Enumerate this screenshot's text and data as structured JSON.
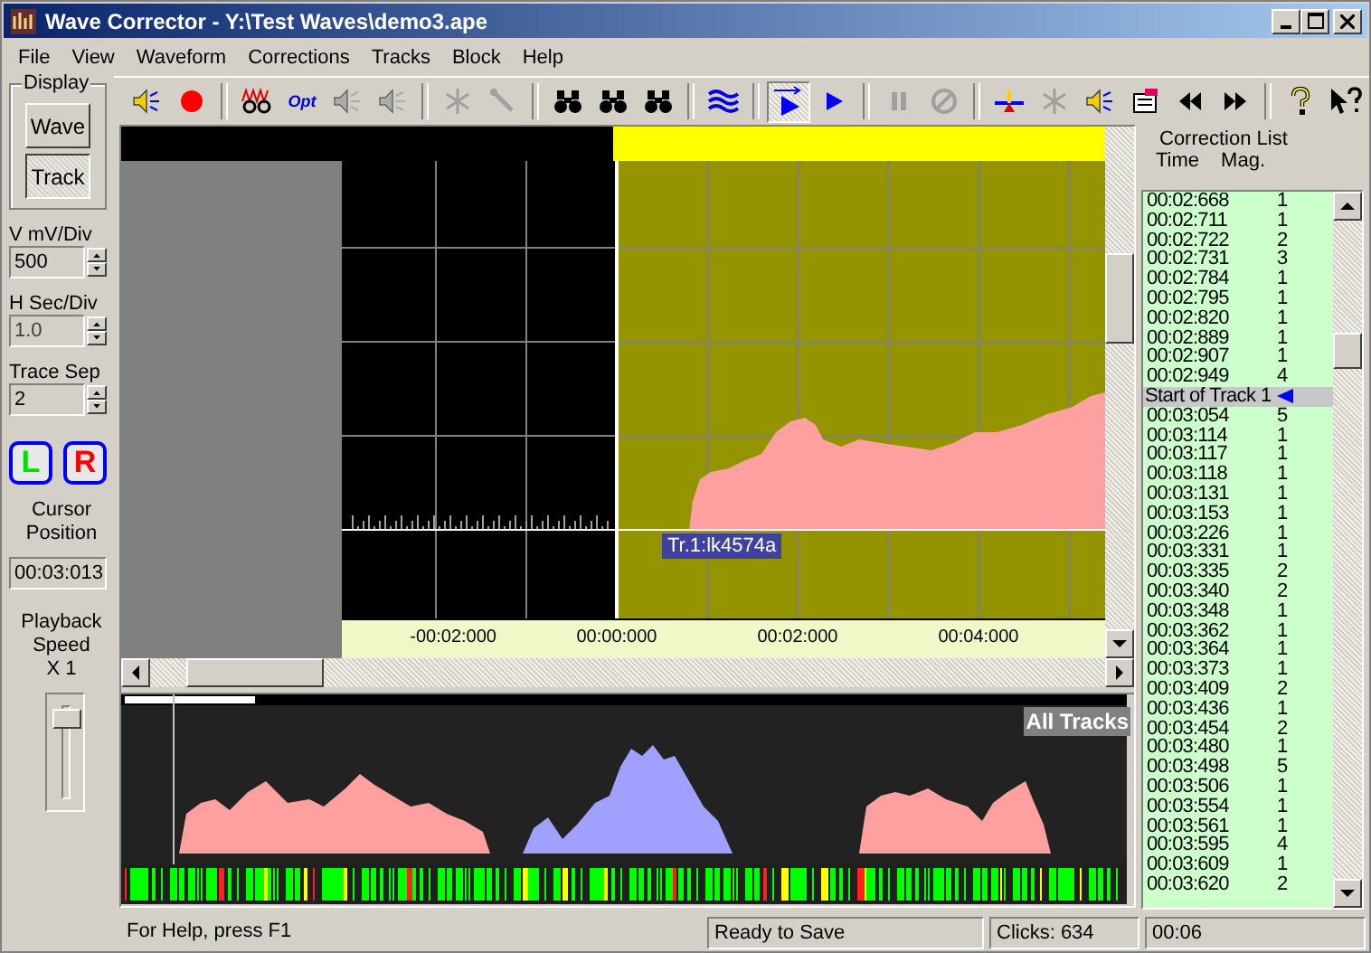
{
  "window": {
    "title": "Wave Corrector - Y:\\Test Waves\\demo3.ape"
  },
  "menu": [
    "File",
    "View",
    "Waveform",
    "Corrections",
    "Tracks",
    "Block",
    "Help"
  ],
  "toolbar": [
    [
      {
        "kind": "speaker",
        "disabled": false,
        "pressed": false
      },
      {
        "kind": "record",
        "disabled": false,
        "pressed": false
      }
    ],
    [
      {
        "kind": "glasses",
        "disabled": false,
        "pressed": false
      },
      {
        "kind": "text",
        "label": "Opt",
        "disabled": false,
        "pressed": false
      },
      {
        "kind": "speaker",
        "disabled": true,
        "pressed": false
      },
      {
        "kind": "speaker",
        "disabled": true,
        "pressed": false
      }
    ],
    [
      {
        "kind": "asterisk",
        "disabled": true,
        "pressed": false
      },
      {
        "kind": "wrench",
        "disabled": true,
        "pressed": false
      }
    ],
    [
      {
        "kind": "binoculars",
        "disabled": false,
        "pressed": false
      },
      {
        "kind": "binoculars",
        "disabled": false,
        "pressed": false
      },
      {
        "kind": "binoculars",
        "disabled": false,
        "pressed": false
      }
    ],
    [
      {
        "kind": "waves",
        "disabled": false,
        "pressed": false
      }
    ],
    [
      {
        "kind": "play-range",
        "disabled": false,
        "pressed": true
      },
      {
        "kind": "play",
        "disabled": false,
        "pressed": false
      }
    ],
    [
      {
        "kind": "pause",
        "disabled": true,
        "pressed": false
      },
      {
        "kind": "stop",
        "disabled": true,
        "pressed": false
      }
    ],
    [
      {
        "kind": "marker",
        "disabled": false,
        "pressed": false
      },
      {
        "kind": "asterisk",
        "disabled": true,
        "pressed": false
      },
      {
        "kind": "speaker",
        "disabled": false,
        "pressed": false
      },
      {
        "kind": "card",
        "disabled": false,
        "pressed": false
      },
      {
        "kind": "rewind",
        "disabled": false,
        "pressed": false
      },
      {
        "kind": "forward",
        "disabled": false,
        "pressed": false
      }
    ],
    [
      {
        "kind": "help",
        "disabled": false,
        "pressed": false
      },
      {
        "kind": "whats-this",
        "disabled": false,
        "pressed": false
      }
    ]
  ],
  "display": {
    "label": "Display",
    "buttons": [
      {
        "label": "Wave",
        "selected": false
      },
      {
        "label": "Track",
        "selected": true
      }
    ]
  },
  "spinners": [
    {
      "label": "V mV/Div",
      "value": "500",
      "disabled": false
    },
    {
      "label": "H Sec/Div",
      "value": "1.0",
      "disabled": true
    },
    {
      "label": "Trace Sep",
      "value": "2",
      "disabled": false
    }
  ],
  "channels": [
    {
      "label": "L",
      "color": "#00e000"
    },
    {
      "label": "R",
      "color": "#ff0000"
    }
  ],
  "cursor": {
    "label": "Cursor Position",
    "value": "00:03:013"
  },
  "playback": {
    "label": "Playback Speed",
    "speed": "X 1",
    "level": 0.9
  },
  "waveform": {
    "ruler": [
      "-00:02:000",
      "00:00:000",
      "00:02:000",
      "00:04:000"
    ],
    "track_label": "Tr.1:lk4574a"
  },
  "overview": {
    "label": "All Tracks"
  },
  "correction_list": {
    "title": "Correction List",
    "columns": [
      "Time",
      "Mag."
    ],
    "rows": [
      {
        "kind": "correction",
        "time": "00:02:668",
        "mag": "1"
      },
      {
        "kind": "correction",
        "time": "00:02:711",
        "mag": "1"
      },
      {
        "kind": "correction",
        "time": "00:02:722",
        "mag": "2"
      },
      {
        "kind": "correction",
        "time": "00:02:731",
        "mag": "3"
      },
      {
        "kind": "correction",
        "time": "00:02:784",
        "mag": "1"
      },
      {
        "kind": "correction",
        "time": "00:02:795",
        "mag": "1"
      },
      {
        "kind": "correction",
        "time": "00:02:820",
        "mag": "1"
      },
      {
        "kind": "correction",
        "time": "00:02:889",
        "mag": "1"
      },
      {
        "kind": "correction",
        "time": "00:02:907",
        "mag": "1"
      },
      {
        "kind": "correction",
        "time": "00:02:949",
        "mag": "4"
      },
      {
        "kind": "track_start",
        "time": "Start of Track 1"
      },
      {
        "kind": "correction",
        "time": "00:03:054",
        "mag": "5"
      },
      {
        "kind": "correction",
        "time": "00:03:114",
        "mag": "1"
      },
      {
        "kind": "correction",
        "time": "00:03:117",
        "mag": "1"
      },
      {
        "kind": "correction",
        "time": "00:03:118",
        "mag": "1"
      },
      {
        "kind": "correction",
        "time": "00:03:131",
        "mag": "1"
      },
      {
        "kind": "correction",
        "time": "00:03:153",
        "mag": "1"
      },
      {
        "kind": "correction",
        "time": "00:03:226",
        "mag": "1"
      },
      {
        "kind": "correction",
        "time": "00:03:331",
        "mag": "1"
      },
      {
        "kind": "correction",
        "time": "00:03:335",
        "mag": "2"
      },
      {
        "kind": "correction",
        "time": "00:03:340",
        "mag": "2"
      },
      {
        "kind": "correction",
        "time": "00:03:348",
        "mag": "1"
      },
      {
        "kind": "correction",
        "time": "00:03:362",
        "mag": "1"
      },
      {
        "kind": "correction",
        "time": "00:03:364",
        "mag": "1"
      },
      {
        "kind": "correction",
        "time": "00:03:373",
        "mag": "1"
      },
      {
        "kind": "correction",
        "time": "00:03:409",
        "mag": "2"
      },
      {
        "kind": "correction",
        "time": "00:03:436",
        "mag": "1"
      },
      {
        "kind": "correction",
        "time": "00:03:454",
        "mag": "2"
      },
      {
        "kind": "correction",
        "time": "00:03:480",
        "mag": "1"
      },
      {
        "kind": "correction",
        "time": "00:03:498",
        "mag": "5"
      },
      {
        "kind": "correction",
        "time": "00:03:506",
        "mag": "1"
      },
      {
        "kind": "correction",
        "time": "00:03:554",
        "mag": "1"
      },
      {
        "kind": "correction",
        "time": "00:03:561",
        "mag": "1"
      },
      {
        "kind": "correction",
        "time": "00:03:595",
        "mag": "4"
      },
      {
        "kind": "correction",
        "time": "00:03:609",
        "mag": "1"
      },
      {
        "kind": "correction",
        "time": "00:03:620",
        "mag": "2"
      }
    ]
  },
  "status_bar": [
    "For Help, press F1",
    "Ready to Save",
    "Clicks: 634",
    "00:06"
  ]
}
